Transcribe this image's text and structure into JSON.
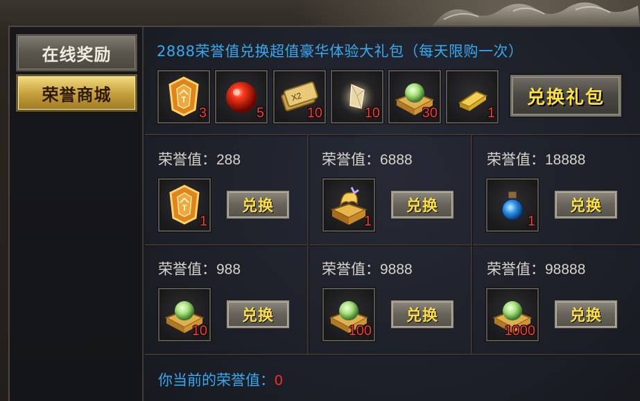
{
  "sidebar": {
    "tabs": [
      {
        "label": "在线奖励",
        "active": false
      },
      {
        "label": "荣誉商城",
        "active": true
      }
    ]
  },
  "banner": {
    "title": "2888荣誉值兑换超值豪华体验大礼包（每天限购一次）",
    "items": [
      {
        "icon": "honor-token-icon",
        "count": "3"
      },
      {
        "icon": "red-orb-icon",
        "count": "5"
      },
      {
        "icon": "double-exp-scroll-icon",
        "count": "10"
      },
      {
        "icon": "crystal-shard-icon",
        "count": "10"
      },
      {
        "icon": "jade-orb-chest-icon",
        "count": "30"
      },
      {
        "icon": "gold-bar-icon",
        "count": "1"
      }
    ],
    "exchange_label": "兑换礼包"
  },
  "shop": {
    "label_prefix": "荣誉值：",
    "button_label": "兑换",
    "cells": [
      {
        "cost": "288",
        "icon": "honor-token-icon",
        "count": "1"
      },
      {
        "cost": "6888",
        "icon": "golden-beast-chest-icon",
        "count": "1"
      },
      {
        "cost": "18888",
        "icon": "blue-potion-icon",
        "count": "1"
      },
      {
        "cost": "988",
        "icon": "jade-orb-chest-icon",
        "count": "10"
      },
      {
        "cost": "9888",
        "icon": "jade-orb-chest-icon",
        "count": "100"
      },
      {
        "cost": "98888",
        "icon": "jade-orb-chest-icon",
        "count": "1000"
      }
    ]
  },
  "footer": {
    "current_label": "你当前的荣誉值：",
    "current_value": "0"
  },
  "colors": {
    "accent_blue": "#33aaf2",
    "count_red": "#ff3b30",
    "button_text_yellow": "#ffe23a",
    "active_tab_gold": "#c8a23e"
  }
}
